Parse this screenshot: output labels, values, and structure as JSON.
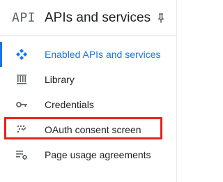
{
  "header": {
    "logo_text": "API",
    "title": "APIs and services",
    "pin_icon": "pin-icon"
  },
  "nav": {
    "items": [
      {
        "label": "Enabled APIs and services",
        "icon": "enabled-apis-icon",
        "active": true
      },
      {
        "label": "Library",
        "icon": "library-icon",
        "active": false
      },
      {
        "label": "Credentials",
        "icon": "key-icon",
        "active": false
      },
      {
        "label": "OAuth consent screen",
        "icon": "oauth-consent-icon",
        "active": false
      },
      {
        "label": "Page usage agreements",
        "icon": "settings-list-icon",
        "active": false
      }
    ]
  },
  "colors": {
    "accent": "#1a73e8",
    "text": "#202124",
    "icon": "#5f6368",
    "highlight": "#e8221a"
  }
}
